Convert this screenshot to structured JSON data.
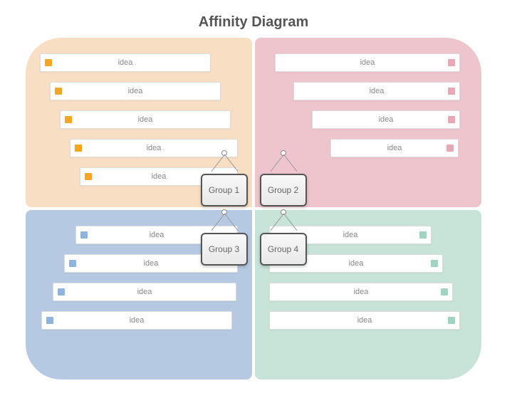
{
  "title": "Affinity Diagram",
  "groups": {
    "g1": {
      "label": "Group 1",
      "ideas": [
        "idea",
        "idea",
        "idea",
        "idea",
        "idea"
      ]
    },
    "g2": {
      "label": "Group 2",
      "ideas": [
        "idea",
        "idea",
        "idea",
        "idea"
      ]
    },
    "g3": {
      "label": "Group 3",
      "ideas": [
        "idea",
        "idea",
        "idea",
        "idea"
      ]
    },
    "g4": {
      "label": "Group 4",
      "ideas": [
        "idea",
        "idea",
        "idea",
        "idea"
      ]
    }
  },
  "colors": {
    "q1_bg": "#f8dfc4",
    "q1_marker": "#f5a623",
    "q2_bg": "#eec4cd",
    "q2_marker": "#e8a6b6",
    "q3_bg": "#b6c9e3",
    "q3_marker": "#8fb4e0",
    "q4_bg": "#c8e3d8",
    "q4_marker": "#9fd4c2"
  }
}
